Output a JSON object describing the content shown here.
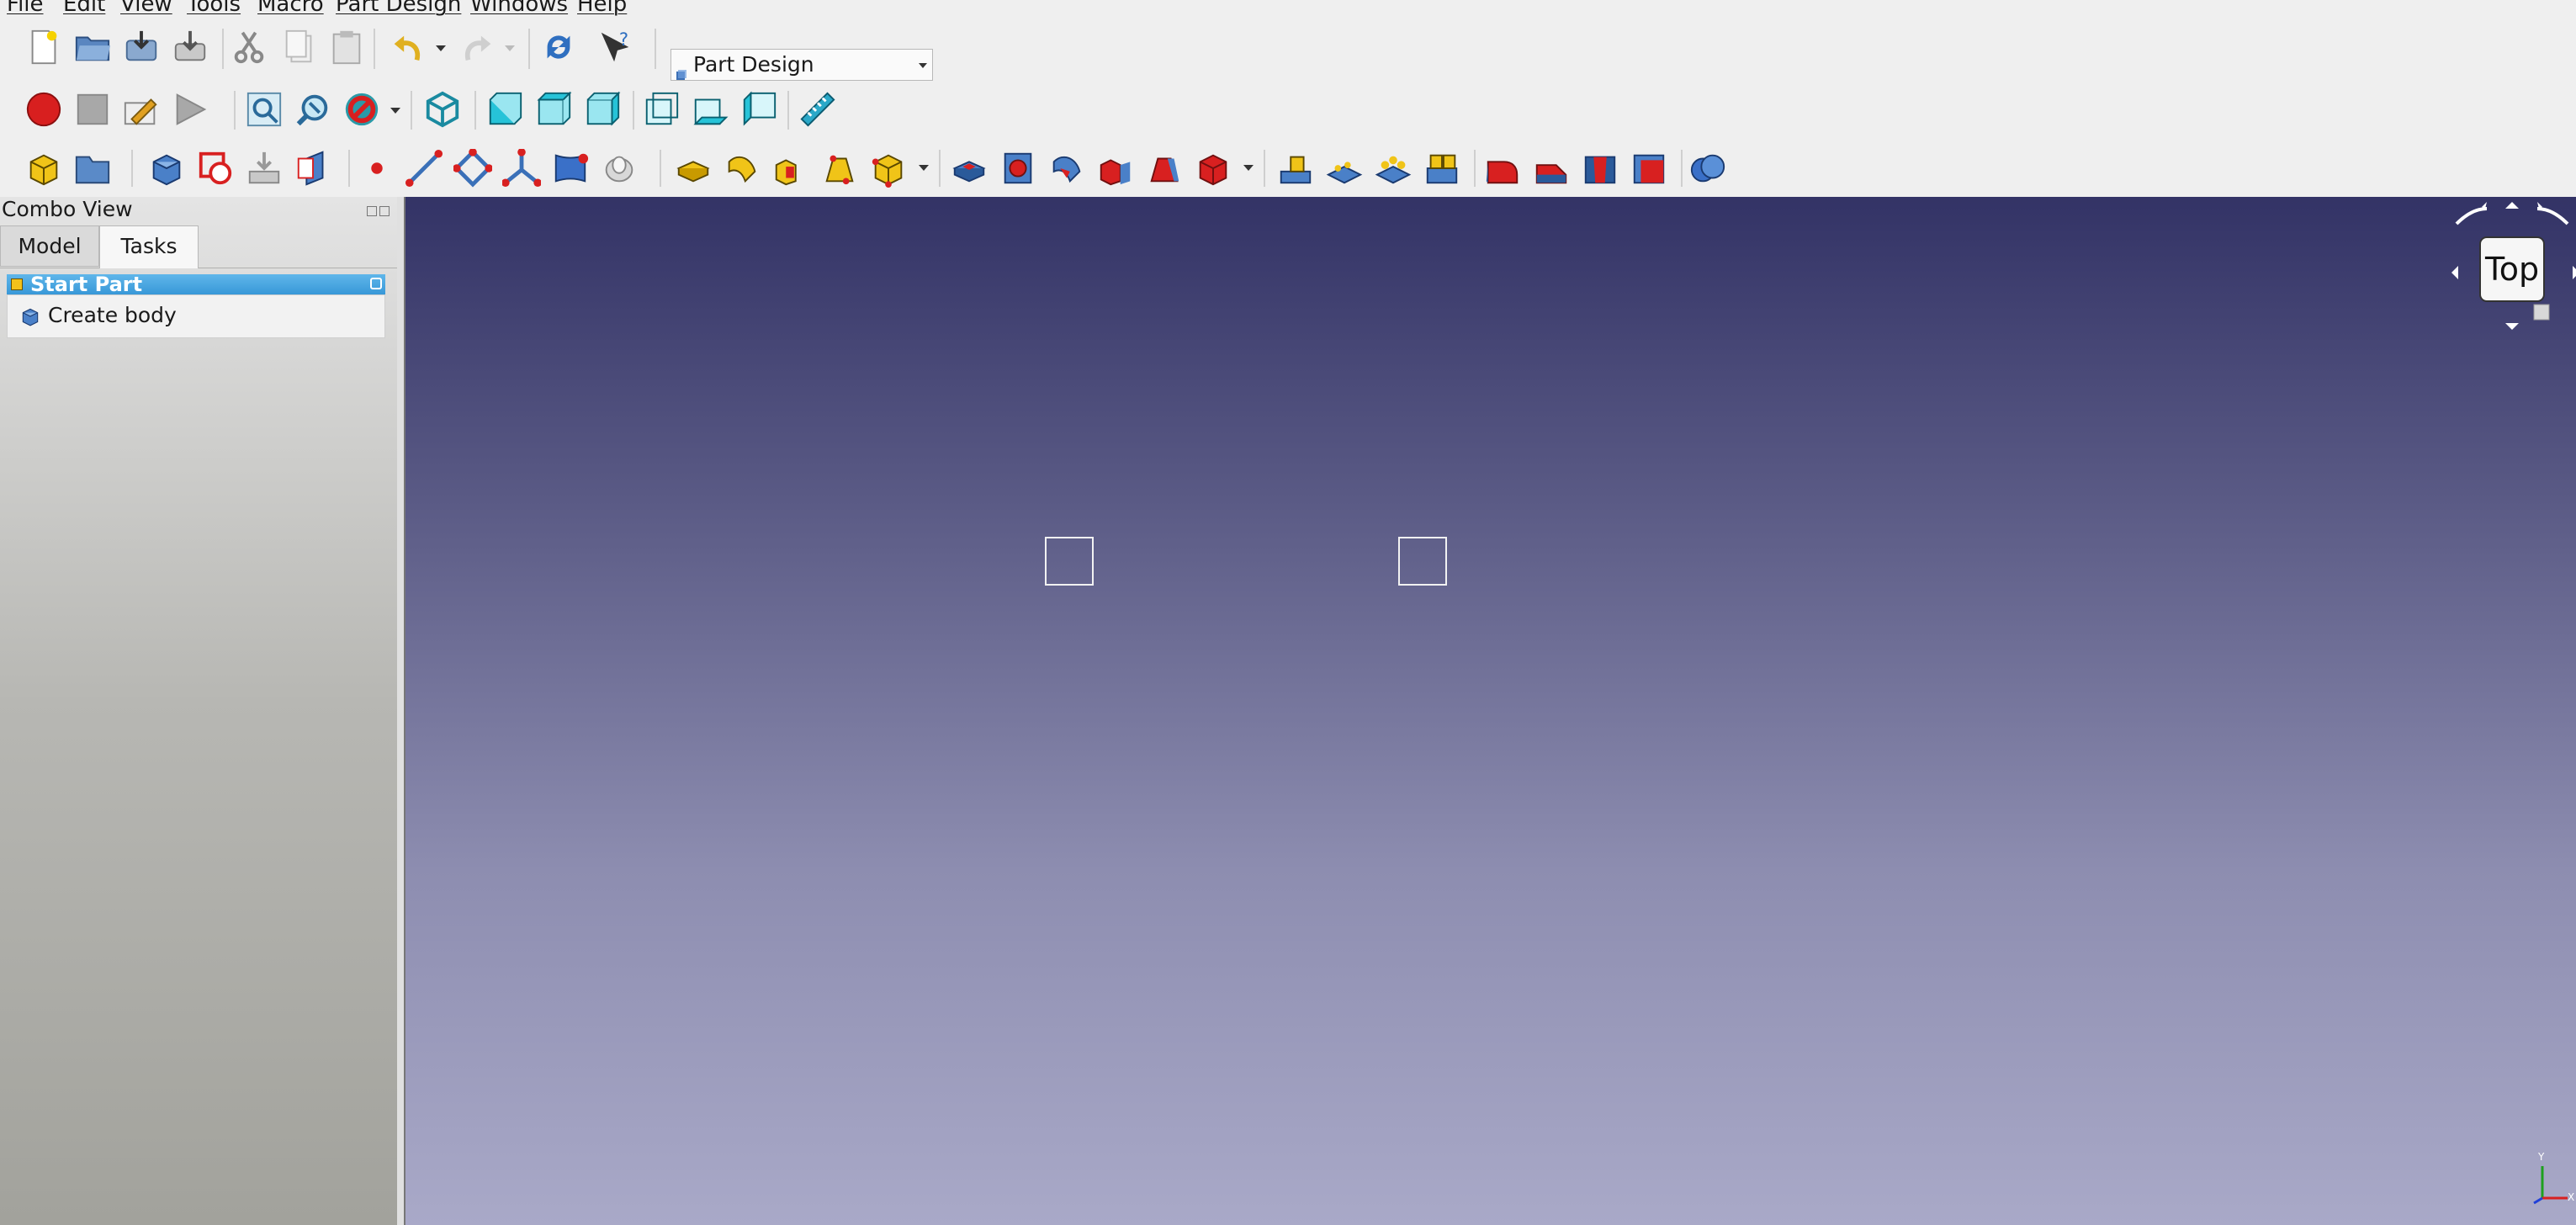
{
  "menubar": {
    "items": [
      "File",
      "Edit",
      "View",
      "Tools",
      "Macro",
      "Part Design",
      "Windows",
      "Help"
    ]
  },
  "toolbar": {
    "workbench_selected": "Part Design"
  },
  "combo_view": {
    "title": "Combo View",
    "tabs": [
      "Model",
      "Tasks"
    ],
    "active_tab": "Tasks",
    "task_panel": {
      "header": "Start Part",
      "items": [
        "Create body"
      ]
    }
  },
  "view3d": {
    "navcube_face": "Top",
    "axis_labels": [
      "Y",
      "X"
    ]
  },
  "colors": {
    "view_top": "#333366",
    "view_bottom": "#a9a9c8",
    "task_header": "#3898d8",
    "record_red": "#d81f1f"
  }
}
